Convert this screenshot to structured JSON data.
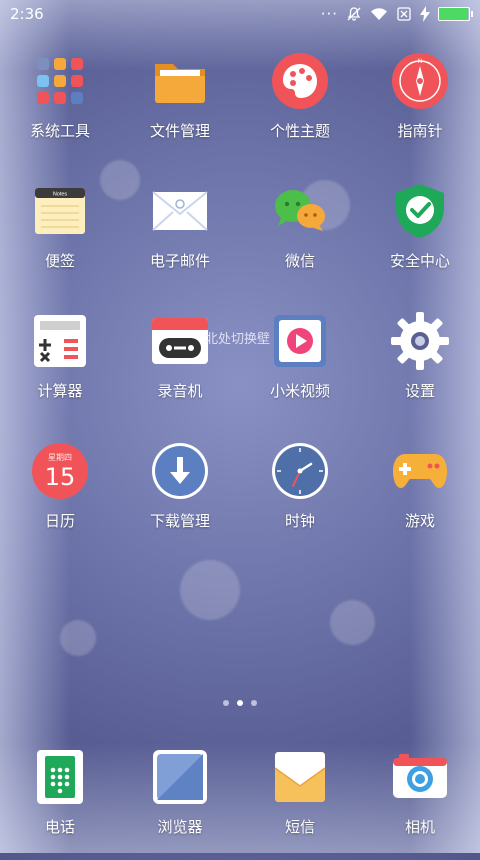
{
  "status_bar": {
    "time": "2:36",
    "battery_level": 0.95,
    "icons": [
      "more-icon",
      "mute-icon",
      "wifi-icon",
      "sim-off-icon",
      "charging-icon",
      "battery-icon"
    ]
  },
  "apps": [
    {
      "id": "system-tools",
      "label": "系统工具",
      "icon": "folder-grid-icon"
    },
    {
      "id": "file-manager",
      "label": "文件管理",
      "icon": "folder-icon"
    },
    {
      "id": "themes",
      "label": "个性主题",
      "icon": "palette-icon"
    },
    {
      "id": "compass",
      "label": "指南针",
      "icon": "compass-icon"
    },
    {
      "id": "notes",
      "label": "便签",
      "icon": "notes-icon",
      "badge_text": "Notes"
    },
    {
      "id": "email",
      "label": "电子邮件",
      "icon": "mail-icon"
    },
    {
      "id": "wechat",
      "label": "微信",
      "icon": "wechat-icon"
    },
    {
      "id": "security",
      "label": "安全中心",
      "icon": "shield-check-icon"
    },
    {
      "id": "calculator",
      "label": "计算器",
      "icon": "calculator-icon"
    },
    {
      "id": "recorder",
      "label": "录音机",
      "icon": "recorder-icon"
    },
    {
      "id": "mi-video",
      "label": "小米视频",
      "icon": "play-icon"
    },
    {
      "id": "settings",
      "label": "设置",
      "icon": "gear-icon"
    },
    {
      "id": "calendar",
      "label": "日历",
      "icon": "calendar-icon",
      "weekday": "星期四",
      "day": "15"
    },
    {
      "id": "downloads",
      "label": "下载管理",
      "icon": "download-icon"
    },
    {
      "id": "clock",
      "label": "时钟",
      "icon": "clock-icon"
    },
    {
      "id": "games",
      "label": "游戏",
      "icon": "gamepad-icon"
    }
  ],
  "overlay_text": "北处切换壁",
  "page_indicator": {
    "count": 3,
    "active": 1
  },
  "dock": [
    {
      "id": "phone",
      "label": "电话",
      "icon": "phone-icon"
    },
    {
      "id": "browser",
      "label": "浏览器",
      "icon": "browser-icon"
    },
    {
      "id": "sms",
      "label": "短信",
      "icon": "sms-icon"
    },
    {
      "id": "camera",
      "label": "相机",
      "icon": "camera-icon"
    }
  ],
  "colors": {
    "accent_red": "#f05458",
    "folder_orange": "#f6a93b",
    "wechat_green": "#4cbf4b",
    "security_green": "#1fa85a",
    "download_blue": "#5b7fc1",
    "game_orange": "#f6b03a",
    "battery_green": "#4cd964"
  }
}
